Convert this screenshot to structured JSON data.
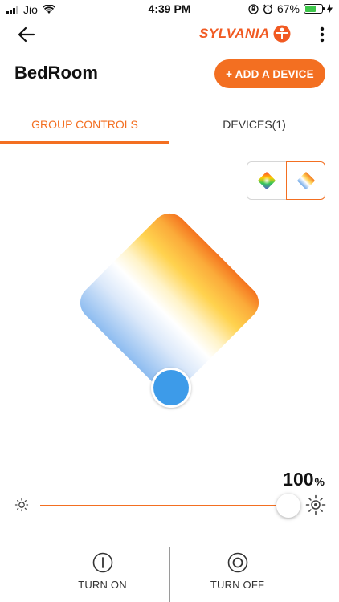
{
  "status_bar": {
    "carrier": "Jio",
    "time": "4:39 PM",
    "battery": "67%",
    "battery_level": 0.67
  },
  "app_bar": {
    "brand": "SYLVANIA",
    "icons": [
      "back-arrow-icon",
      "sylvania-logo-icon",
      "more-vert-icon"
    ]
  },
  "header": {
    "room_name": "BedRoom",
    "add_device_label": "+ ADD A DEVICE"
  },
  "tabs": [
    {
      "label": "GROUP CONTROLS",
      "selected": true
    },
    {
      "label": "DEVICES(1)",
      "selected": false
    }
  ],
  "mode_toggle": {
    "options": [
      "color-mode-icon",
      "white-temperature-mode-icon"
    ],
    "selected": "white-temperature-mode-icon"
  },
  "brightness": {
    "value": "100",
    "unit": "%",
    "level": 1.0
  },
  "actions": {
    "turn_on_label": "TURN ON",
    "turn_off_label": "TURN OFF"
  },
  "colors": {
    "accent": "#f36f21",
    "knob": "#3d9be9",
    "warm_top": "#f47a1f",
    "warm_mid": "#ffd45a",
    "cool_bottom": "#9fc6f2"
  }
}
